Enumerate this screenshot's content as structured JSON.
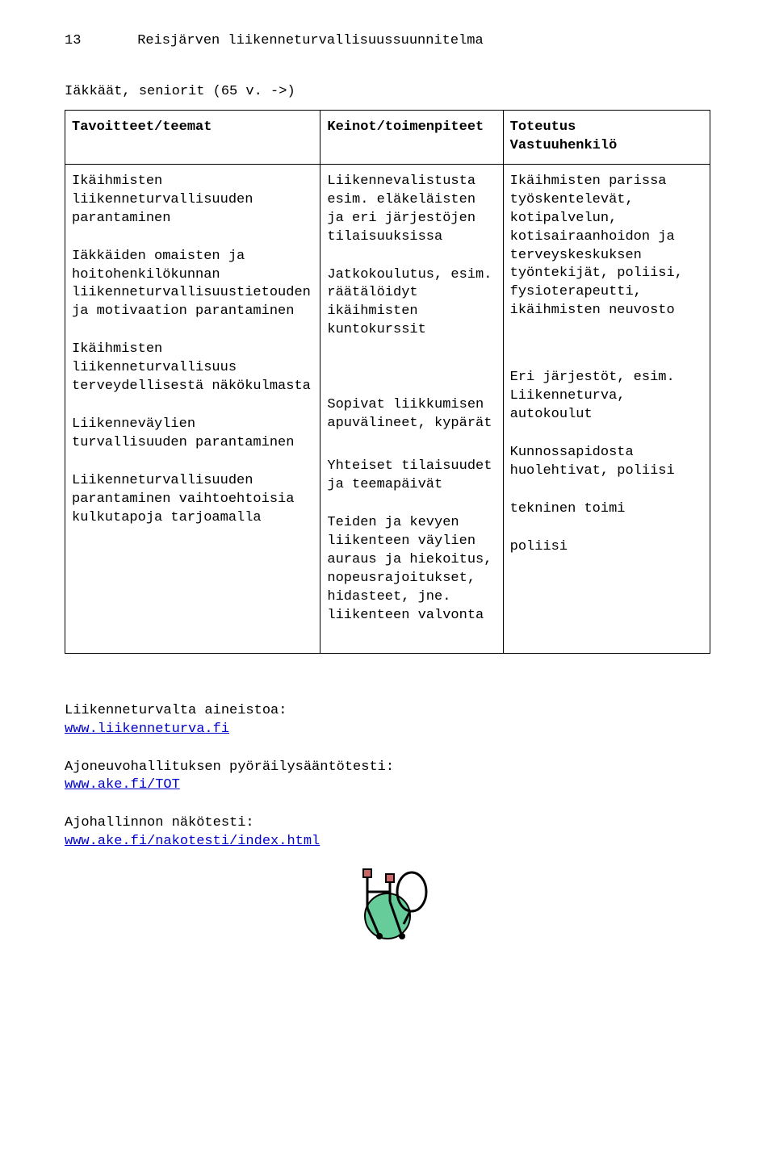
{
  "header": {
    "page_number": "13",
    "doc_title": "Reisjärven liikenneturvallisuussuunnitelma"
  },
  "subtitle": "Iäkkäät, seniorit (65 v. ->)",
  "table": {
    "head": {
      "c1": "Tavoitteet/teemat",
      "c2": "Keinot/toimenpiteet",
      "c3_a": "Toteutus",
      "c3_b": "Vastuuhenkilö"
    },
    "body": {
      "c1_p1": "Ikäihmisten liikenneturvallisuuden parantaminen",
      "c1_p2": "Iäkkäiden omaisten ja hoitohenkilökunnan liikenneturvallisuustietouden ja motivaation parantaminen",
      "c1_p3": "Ikäihmisten liikenneturvallisuus terveydellisestä näkökulmasta",
      "c1_p4": "Liikenneväylien turvallisuuden parantaminen",
      "c1_p5": "Liikenneturvallisuuden parantaminen vaihtoehtoisia kulkutapoja tarjoamalla",
      "c2_p1": "Liikennevalistusta esim. eläkeläisten ja eri järjestöjen tilaisuuksissa",
      "c2_p2": "Jatkokoulutus, esim. räätälöidyt ikäihmisten kuntokurssit",
      "c2_p3": "Sopivat liikkumisen apuvälineet, kypärät",
      "c2_p4": "Yhteiset tilaisuudet ja teemapäivät",
      "c2_p5": "Teiden ja kevyen liikenteen väylien auraus ja hiekoitus, nopeusrajoitukset, hidasteet, jne. liikenteen valvonta",
      "c3_p1": "Ikäihmisten parissa työskentelevät, kotipalvelun, kotisairaanhoidon ja terveyskeskuksen työntekijät, poliisi, fysioterapeutti, ikäihmisten neuvosto",
      "c3_p2": "Eri järjestöt, esim. Liikenneturva, autokoulut",
      "c3_p3": "Kunnossapidosta huolehtivat, poliisi",
      "c3_p4": "tekninen toimi",
      "c3_p5": "poliisi"
    }
  },
  "footer": {
    "src1_label": "Liikenneturvalta aineistoa:",
    "src1_link": "www.liikenneturva.fi",
    "src2_label": "Ajoneuvohallituksen pyöräilysääntötesti:",
    "src2_link": "www.ake.fi/TOT",
    "src3_label": "Ajohallinnon näkötesti:",
    "src3_link": "www.ake.fi/nakotesti/index.html"
  }
}
